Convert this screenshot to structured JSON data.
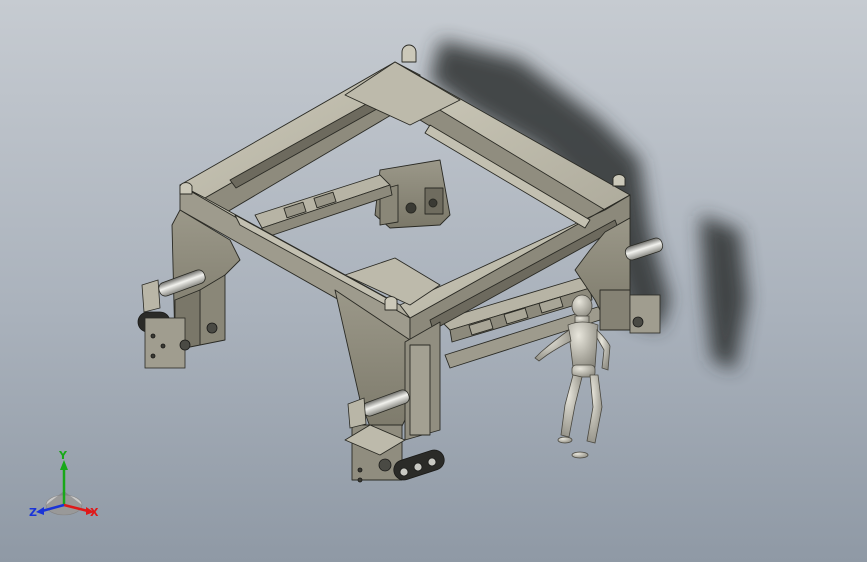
{
  "triad": {
    "x_label": "X",
    "y_label": "Y",
    "z_label": "Z",
    "x_color": "#e01818",
    "y_color": "#18a818",
    "z_color": "#1a34d8"
  },
  "colors": {
    "steel": "#a8a596",
    "steel_light": "#c8c5b5",
    "steel_dark": "#7d7a6c",
    "edge": "#2a2a24",
    "shadow": "#2f3032",
    "background_top": "#c6cbd1",
    "background_bottom": "#8f99a5"
  }
}
